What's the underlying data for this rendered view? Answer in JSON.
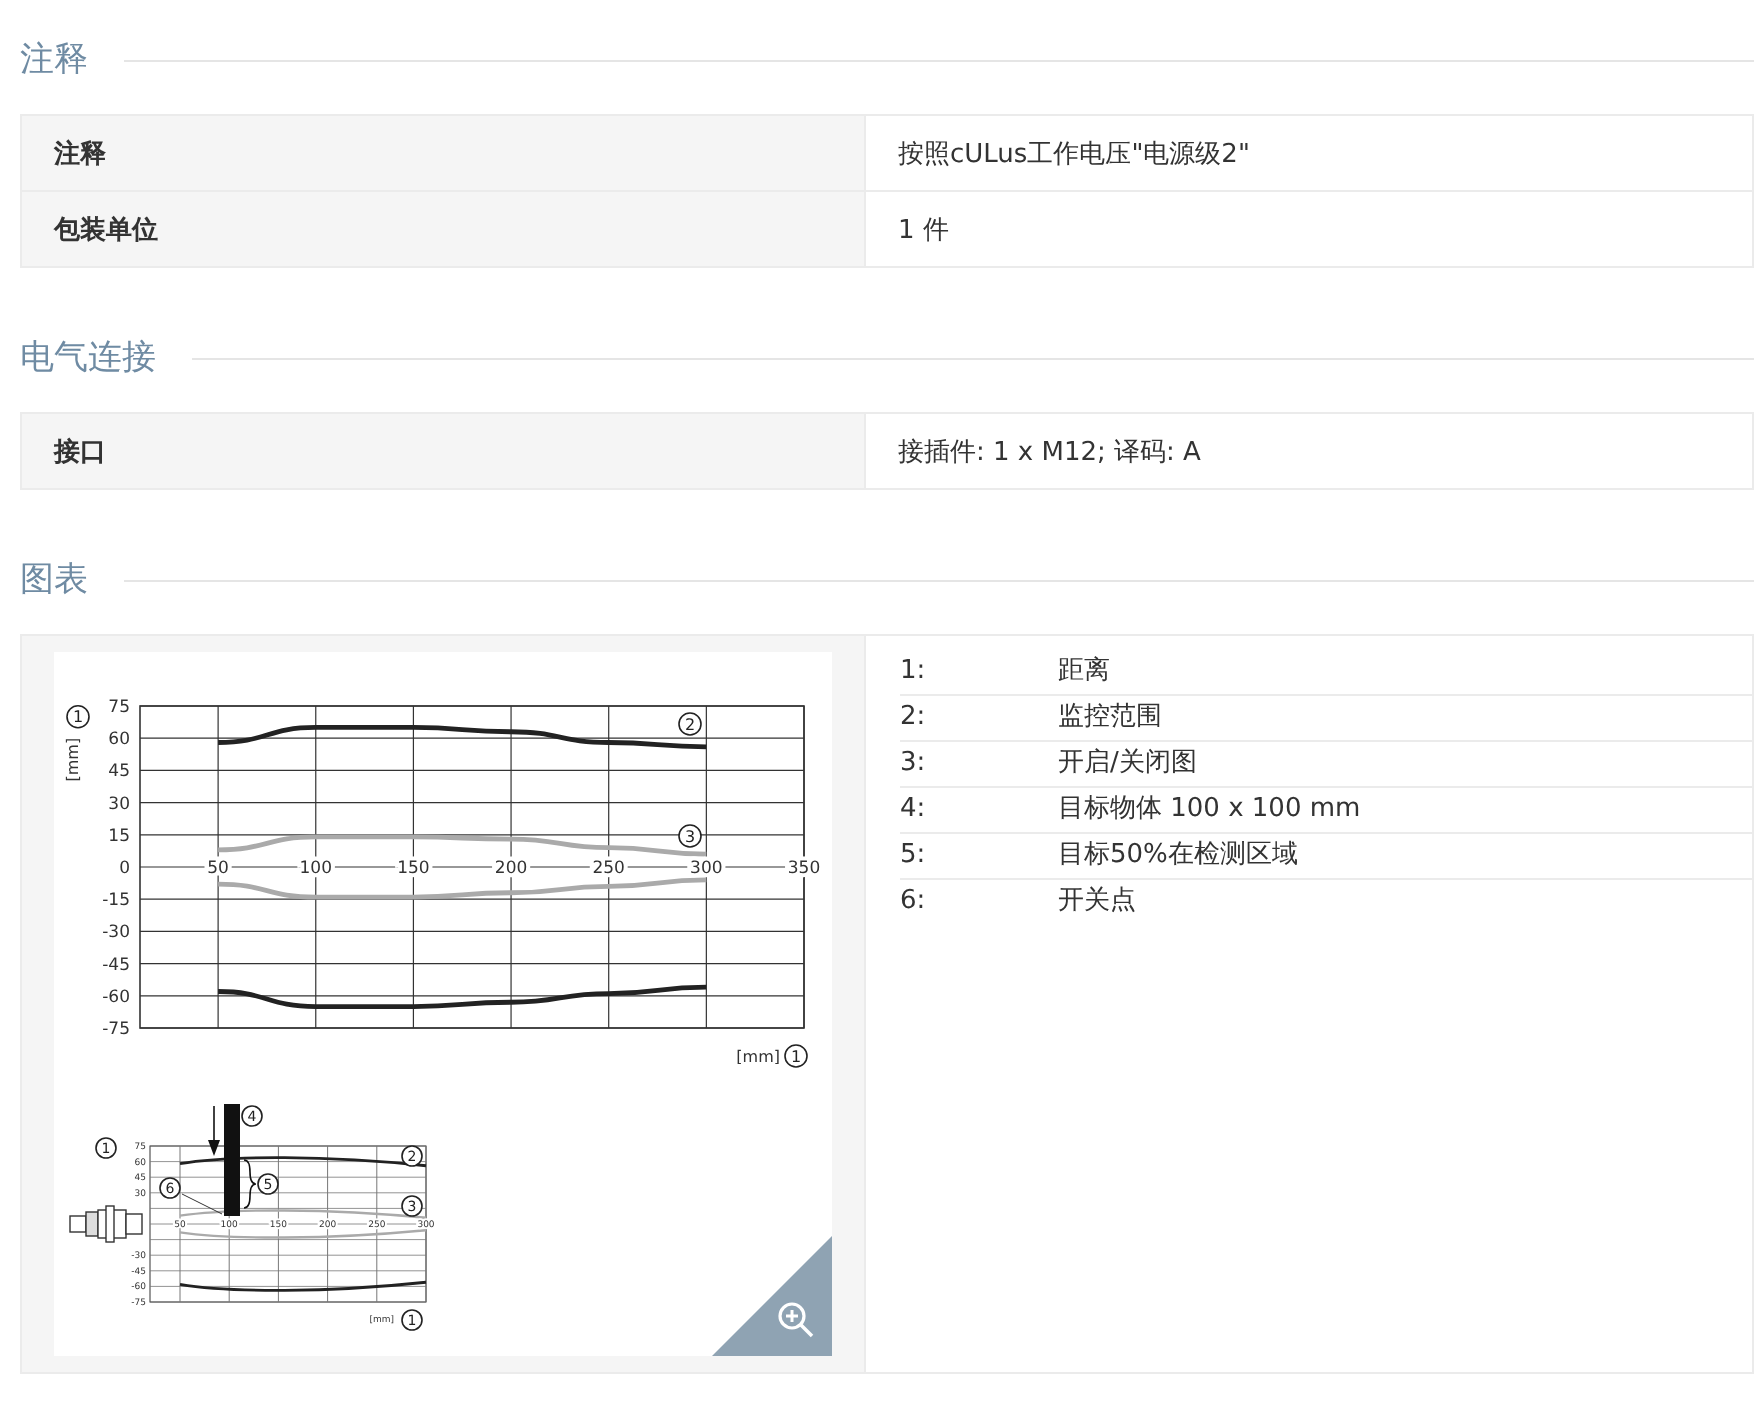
{
  "sections": [
    {
      "title": "注释",
      "kind": "table",
      "rows": [
        {
          "label": "注释",
          "value": "按照cULus工作电压\"电源级2\""
        },
        {
          "label": "包装单位",
          "value": "1 件"
        }
      ]
    },
    {
      "title": "电气连接",
      "kind": "table",
      "rows": [
        {
          "label": "接口",
          "value": "接插件: 1 x M12; 译码: A"
        }
      ]
    },
    {
      "title": "图表",
      "kind": "diagram",
      "figure": {
        "chart_data": {
          "type": "line",
          "ylabel": "[mm]",
          "xlabel": "[mm]",
          "x": [
            50,
            100,
            150,
            200,
            250,
            300
          ],
          "xlim": [
            10,
            350
          ],
          "ylim": [
            -75,
            75
          ],
          "xticks": [
            50,
            100,
            150,
            200,
            250,
            300,
            350
          ],
          "yticks": [
            -75,
            -60,
            -45,
            -30,
            -15,
            0,
            15,
            30,
            45,
            60,
            75
          ],
          "series": [
            {
              "color": "#222222",
              "values": [
                58,
                65,
                65,
                63,
                58,
                56
              ]
            },
            {
              "color": "#222222",
              "values": [
                -58,
                -65,
                -65,
                -63,
                -59,
                -56
              ]
            },
            {
              "color": "#aaaaaa",
              "values": [
                8,
                14,
                14,
                13,
                9,
                6
              ]
            },
            {
              "color": "#aaaaaa",
              "values": [
                -8,
                -14,
                -14,
                -12,
                -9,
                -6
              ]
            }
          ],
          "grid": true
        },
        "y_callout": "1",
        "x_callout": "1",
        "curve_callouts": [
          "2",
          "3"
        ],
        "drawing": {
          "y_ticks": [
            "75",
            "60",
            "45",
            "30",
            "-30",
            "-45",
            "-60",
            "-75"
          ],
          "x_ticks": [
            "50",
            "100",
            "150",
            "200",
            "250",
            "300"
          ],
          "unit": "[mm]",
          "callouts": [
            "1",
            "2",
            "3",
            "4",
            "5",
            "6",
            "1"
          ]
        }
      },
      "legend": [
        {
          "number": "1:",
          "text": "距离"
        },
        {
          "number": "2:",
          "text": "监控范围"
        },
        {
          "number": "3:",
          "text": "开启/关闭图"
        },
        {
          "number": "4:",
          "text": "目标物体 100 x 100 mm"
        },
        {
          "number": "5:",
          "text": "目标50%在检测区域"
        },
        {
          "number": "6:",
          "text": "开关点"
        }
      ]
    }
  ]
}
